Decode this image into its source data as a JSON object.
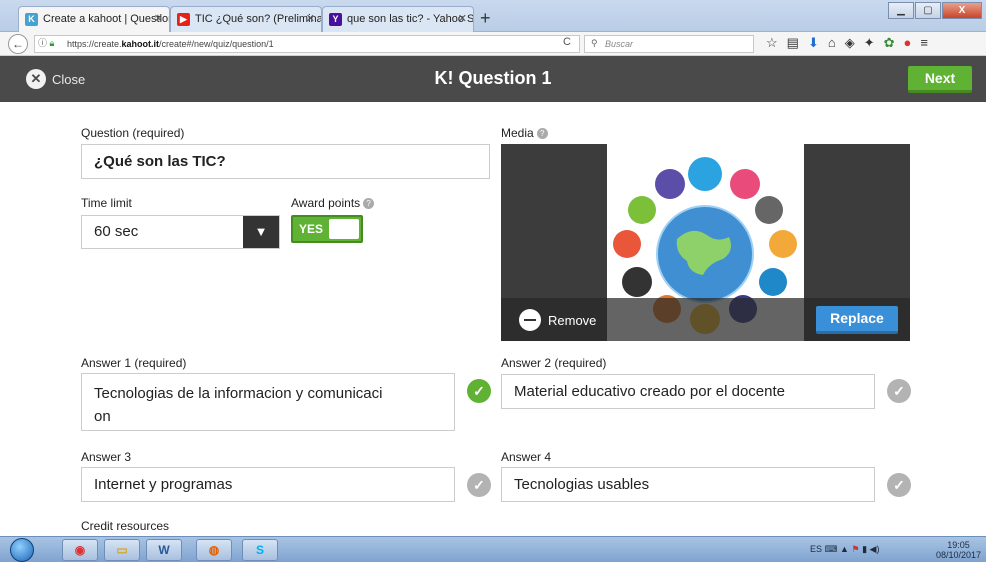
{
  "browser": {
    "tabs": [
      {
        "title": "Create a kahoot | Question",
        "favicon": "K!",
        "favicon_color": "#46a2d0"
      },
      {
        "title": "TIC ¿Qué son? (Preliminar) -",
        "favicon": "▶",
        "favicon_color": "#e62117"
      },
      {
        "title": "que son las tic? - Yahoo Sear",
        "favicon": "Y",
        "favicon_color": "#4b0f9e"
      }
    ],
    "url_prefix": "https://create.",
    "url_domain": "kahoot.it",
    "url_suffix": "/create#/new/quiz/question/1",
    "search_placeholder": "Buscar"
  },
  "header": {
    "close_label": "Close",
    "title": "K! Question 1",
    "next_label": "Next"
  },
  "form": {
    "question_label": "Question (required)",
    "question_value": "¿Qué son las TIC?",
    "time_limit_label": "Time limit",
    "time_limit_value": "60 sec",
    "award_points_label": "Award points",
    "award_points_value": "YES",
    "media_label": "Media",
    "remove_label": "Remove",
    "replace_label": "Replace",
    "answers": [
      {
        "label": "Answer 1 (required)",
        "value_line1": "Tecnologias de la informacion y comunicaci",
        "value_line2": "on",
        "correct": true
      },
      {
        "label": "Answer 2 (required)",
        "value": "Material educativo creado por el docente",
        "correct": false
      },
      {
        "label": "Answer 3",
        "value": "Internet y programas",
        "correct": false
      },
      {
        "label": "Answer 4",
        "value": "Tecnologias usables",
        "correct": false
      }
    ],
    "credit_label": "Credit resources"
  },
  "taskbar": {
    "lang": "ES",
    "time": "19:05",
    "date": "08/10/2017"
  },
  "colors": {
    "header_bg": "#4a4a4a",
    "accent_green": "#5fb233",
    "accent_blue": "#3a8fd9"
  }
}
